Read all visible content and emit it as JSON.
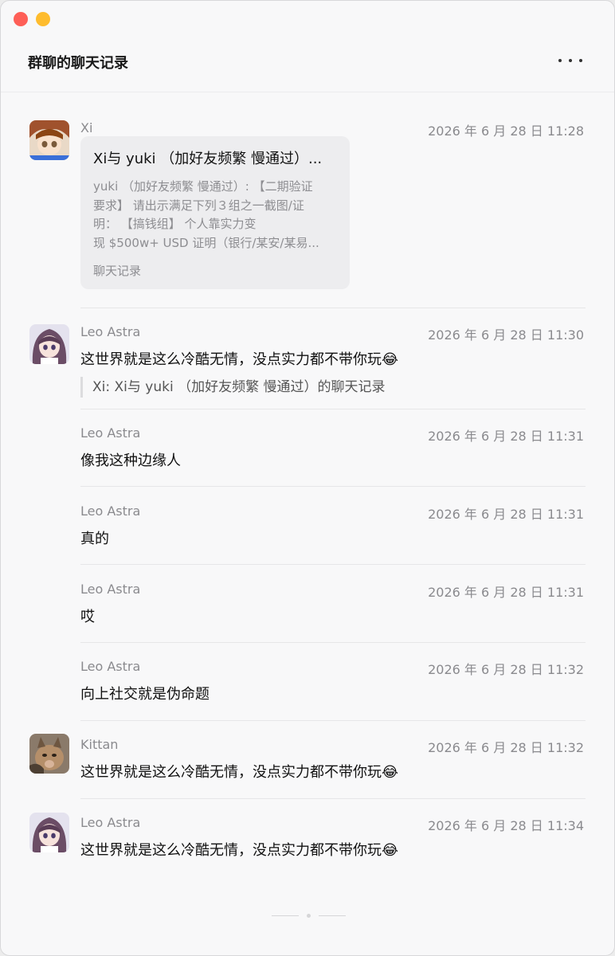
{
  "window": {
    "title": "群聊的聊天记录"
  },
  "messages": [
    {
      "sender": "Xi",
      "time": "2026 年 6 月 28 日 11:28",
      "card": {
        "title": "Xi与 yuki （加好友频繁 慢通过）...",
        "preview": [
          "yuki （加好友频繁 慢通过）: 【二期验证",
          "要求】 请出示满足下列３组之一截图/证",
          "明：    【搞钱组】 个人靠实力变",
          "现 $500w+ USD 证明（银行/某安/某易..."
        ],
        "footer": "聊天记录"
      }
    },
    {
      "sender": "Leo Astra",
      "time": "2026 年 6 月 28 日 11:30",
      "text": "这世界就是这么冷酷无情，没点实力都不带你玩😂",
      "quote": "Xi: Xi与 yuki （加好友频繁 慢通过）的聊天记录"
    },
    {
      "sender": "Leo Astra",
      "time": "2026 年 6 月 28 日 11:31",
      "text": "像我这种边缘人"
    },
    {
      "sender": "Leo Astra",
      "time": "2026 年 6 月 28 日 11:31",
      "text": "真的"
    },
    {
      "sender": "Leo Astra",
      "time": "2026 年 6 月 28 日 11:31",
      "text": "哎"
    },
    {
      "sender": "Leo Astra",
      "time": "2026 年 6 月 28 日 11:32",
      "text": "向上社交就是伪命题"
    },
    {
      "sender": "Kittan",
      "time": "2026 年 6 月 28 日 11:32",
      "text": "这世界就是这么冷酷无情，没点实力都不带你玩😂"
    },
    {
      "sender": "Leo Astra",
      "time": "2026 年 6 月 28 日 11:34",
      "text": "这世界就是这么冷酷无情，没点实力都不带你玩😂"
    }
  ]
}
